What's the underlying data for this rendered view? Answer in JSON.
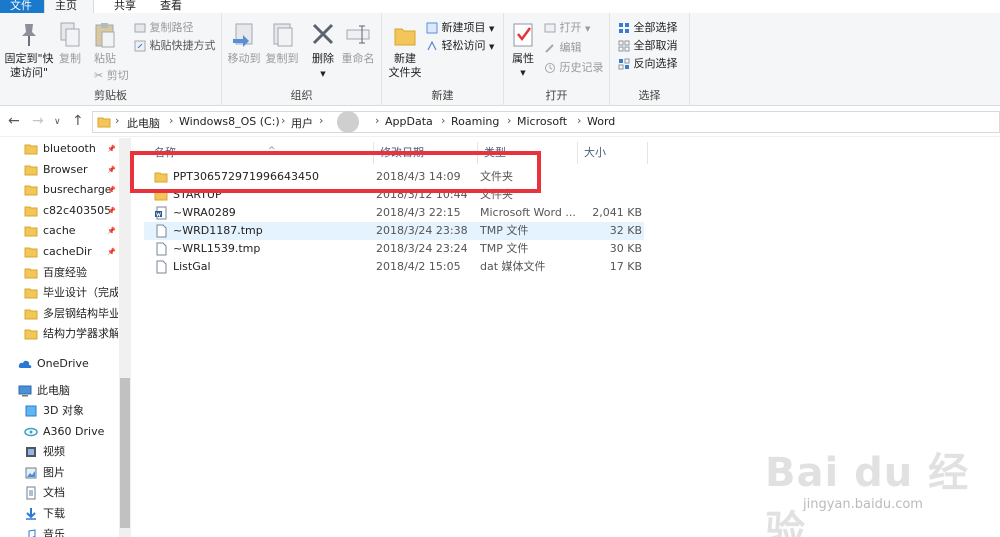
{
  "ribbon_tabs": {
    "file": "文件",
    "home": "主页",
    "share": "共享",
    "view": "查看"
  },
  "clipboard": {
    "pin": "固定到\"快速访问\"",
    "copy": "复制",
    "paste": "粘贴",
    "copy_path": "复制路径",
    "paste_shortcut": "粘贴快捷方式",
    "cut": "剪切",
    "label": "剪贴板"
  },
  "organize": {
    "move_to": "移动到",
    "copy_to": "复制到",
    "delete": "删除",
    "rename": "重命名",
    "label": "组织"
  },
  "new": {
    "new_folder": "新建\n文件夹",
    "new_item": "新建项目",
    "easy_access": "轻松访问",
    "label": "新建"
  },
  "open": {
    "properties": "属性",
    "open": "打开",
    "edit": "编辑",
    "history": "历史记录",
    "label": "打开"
  },
  "select": {
    "select_all": "全部选择",
    "select_none": "全部取消",
    "invert": "反向选择",
    "label": "选择"
  },
  "address": {
    "crumbs": [
      "此电脑",
      "Windows8_OS (C:)",
      "用户",
      "",
      "AppData",
      "Roaming",
      "Microsoft",
      "Word"
    ]
  },
  "navpane": {
    "quick_items": [
      "bluetooth",
      "Browser",
      "busrecharge",
      "c82c403505",
      "cache",
      "cacheDir",
      "百度经验",
      "毕业设计（完成",
      "多层钢结构毕业",
      "结构力学器求解"
    ],
    "onedrive": "OneDrive",
    "this_pc": "此电脑",
    "pc_items": [
      "3D 对象",
      "A360 Drive",
      "视频",
      "图片",
      "文档",
      "下载",
      "音乐"
    ]
  },
  "columns": {
    "name": "名称",
    "date": "修改日期",
    "type": "类型",
    "size": "大小"
  },
  "files": [
    {
      "name": "PPT306572971996643450",
      "date": "2018/4/3 14:09",
      "type": "文件夹",
      "size": "",
      "icon": "folder-icon"
    },
    {
      "name": "STARTUP",
      "date": "2018/3/12 10:44",
      "type": "文件夹",
      "size": "",
      "icon": "folder-icon"
    },
    {
      "name": "~WRA0289",
      "date": "2018/4/3 22:15",
      "type": "Microsoft Word ...",
      "size": "2,041 KB",
      "icon": "word-doc-icon"
    },
    {
      "name": "~WRD1187.tmp",
      "date": "2018/3/24 23:38",
      "type": "TMP 文件",
      "size": "32 KB",
      "icon": "file-icon"
    },
    {
      "name": "~WRL1539.tmp",
      "date": "2018/3/24 23:24",
      "type": "TMP 文件",
      "size": "30 KB",
      "icon": "file-icon"
    },
    {
      "name": "ListGal",
      "date": "2018/4/2 15:05",
      "type": "dat 媒体文件",
      "size": "17 KB",
      "icon": "file-icon"
    }
  ],
  "watermark": {
    "main": "Bai du 经验",
    "sub": "jingyan.baidu.com"
  },
  "colors": {
    "accent": "#1979ca",
    "highlight": "#e8323c",
    "folder": "#f4c558"
  }
}
